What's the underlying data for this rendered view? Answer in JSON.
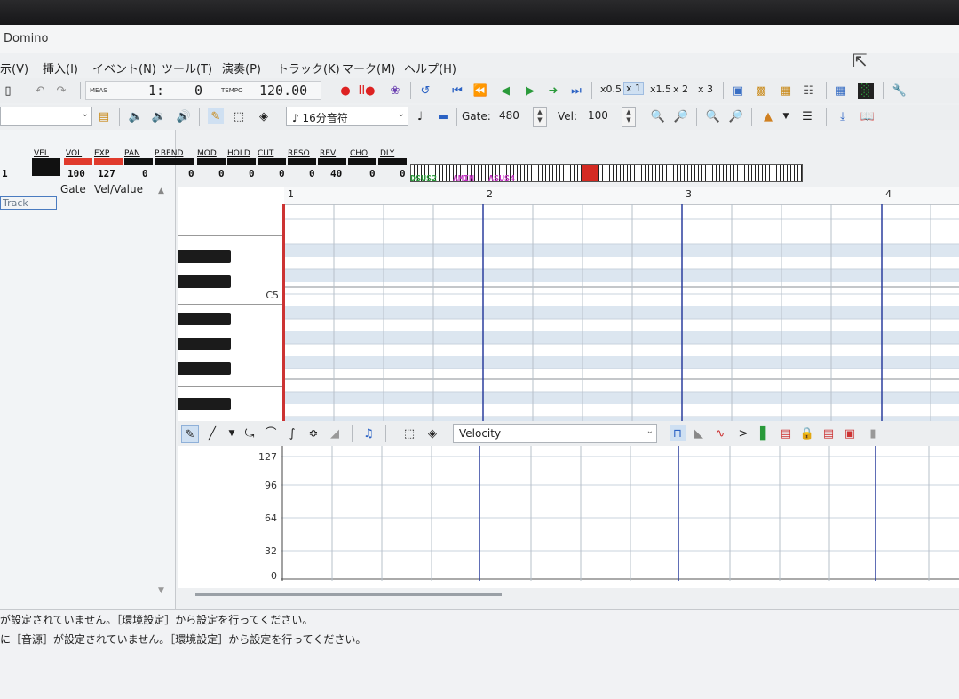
{
  "window": {
    "title": "Domino"
  },
  "menu": [
    "示(V)",
    "挿入(I)",
    "イベント(N)",
    "ツール(T)",
    "演奏(P)",
    "トラック(K)",
    "マーク(M)",
    "ヘルプ(H)"
  ],
  "transport": {
    "meas_label": "MEAS",
    "meas_value": "1:",
    "tick_value": "0",
    "tempo_label": "TEMPO",
    "tempo_value": "120.00",
    "speeds": [
      "x0.5",
      "x 1",
      "x1.5",
      "x 2",
      "x 3"
    ],
    "active_speed": "x 1"
  },
  "edit": {
    "note_length": "16分音符",
    "gate_label": "Gate:",
    "gate_value": "480",
    "vel_label": "Vel:",
    "vel_value": "100"
  },
  "mixer": {
    "labels": [
      "VEL",
      "VOL",
      "EXP",
      "PAN",
      "P.BEND",
      "MOD",
      "HOLD",
      "CUT",
      "RESO",
      "REV",
      "CHO",
      "DLY"
    ],
    "values": [
      "100",
      "127",
      "0",
      "0",
      "0",
      "0",
      "0",
      "0",
      "40",
      "0",
      "0"
    ],
    "track_number": "1",
    "chords": [
      "DSUS2",
      "AMIN",
      "ASUS4"
    ]
  },
  "track_list": {
    "columns": [
      "Gate",
      "Vel/Value"
    ],
    "track_placeholder": "Track"
  },
  "piano_roll": {
    "measures": [
      "1",
      "2",
      "3",
      "4"
    ],
    "key_label": "C5"
  },
  "velocity_pane": {
    "combo_value": "Velocity",
    "y_labels": [
      "127",
      "96",
      "64",
      "32",
      "0"
    ]
  },
  "status": {
    "line1": "が設定されていません。［環境設定］から設定を行ってください。",
    "line2": "に［音源］が設定されていません。［環境設定］から設定を行ってください。"
  },
  "colors": {
    "accent_red": "#e03a2c",
    "measure_line": "#2b3f9e",
    "grid_light": "#dce6f0"
  }
}
